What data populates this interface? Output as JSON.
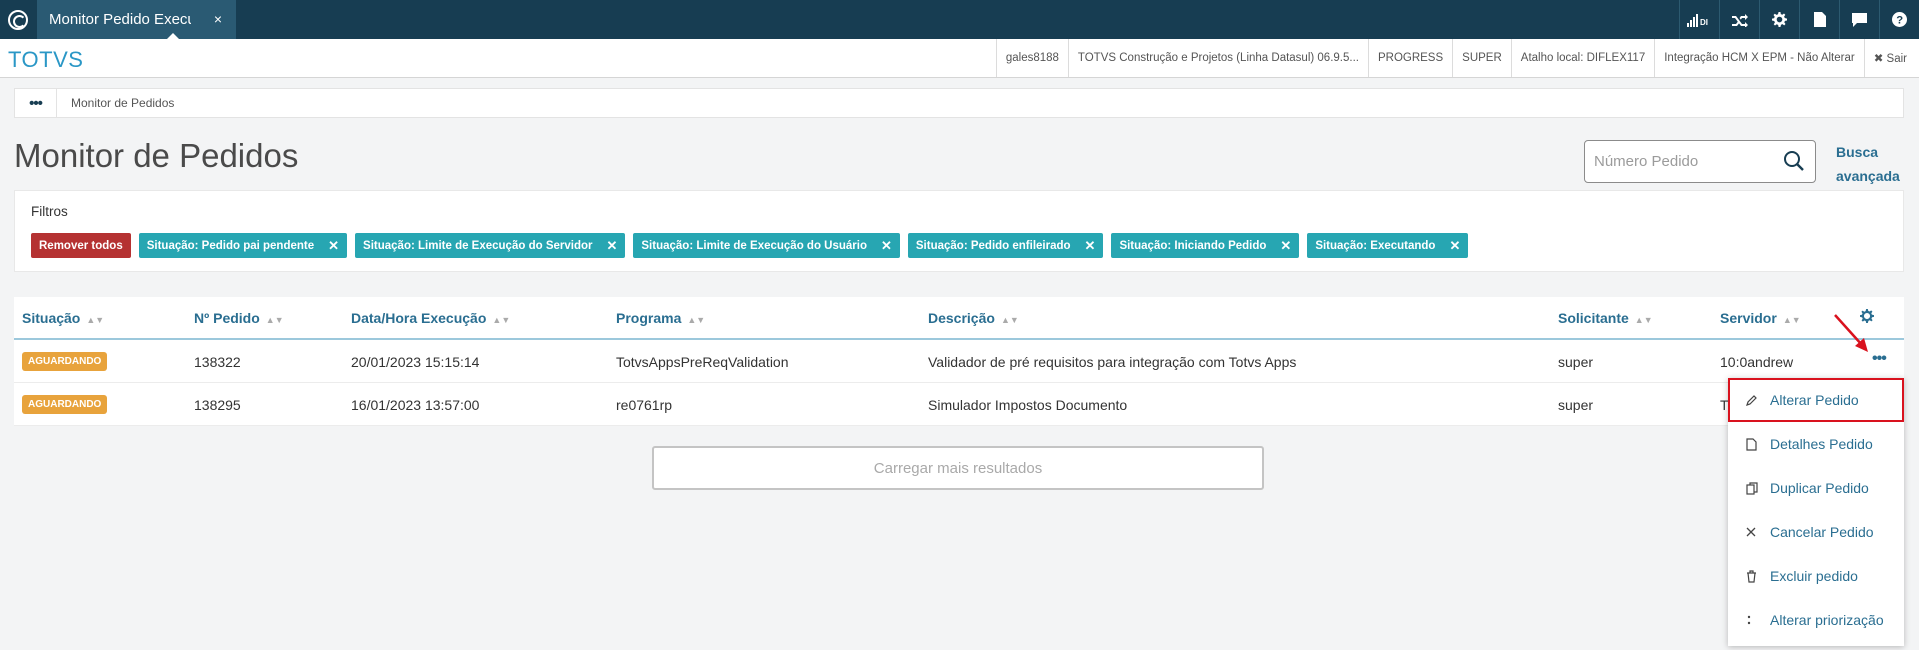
{
  "topbar": {
    "tab_title": "Monitor Pedido Execução",
    "tab_close": "×",
    "icons": [
      "signal-icon",
      "shuffle-icon",
      "gear-icon",
      "document-icon",
      "chat-icon",
      "help-icon"
    ],
    "signal_label": "DI"
  },
  "header": {
    "brand": "TOTVS",
    "info": [
      "gales8188",
      "TOTVS Construção e Projetos (Linha Datasul) 06.9.5...",
      "PROGRESS",
      "SUPER",
      "Atalho local: DIFLEX117",
      "Integração HCM X EPM - Não Alterar"
    ],
    "logout": "✖ Sair"
  },
  "breadcrumb": {
    "dots": "•••",
    "current": "Monitor de Pedidos"
  },
  "page": {
    "title": "Monitor de Pedidos",
    "search_placeholder": "Número Pedido",
    "advanced_search": "Busca avançada"
  },
  "filters": {
    "title": "Filtros",
    "remove_all": "Remover todos",
    "chips": [
      "Situação: Pedido pai pendente",
      "Situação: Limite de Execução do Servidor",
      "Situação: Limite de Execução do Usuário",
      "Situação: Pedido enfileirado",
      "Situação: Iniciando Pedido",
      "Situação: Executando"
    ]
  },
  "table": {
    "columns": [
      "Situação",
      "Nº Pedido",
      "Data/Hora Execução",
      "Programa",
      "Descrição",
      "Solicitante",
      "Servidor"
    ],
    "rows": [
      {
        "status": "AGUARDANDO",
        "pedido": "138322",
        "data": "20/01/2023 15:15:14",
        "programa": "TotvsAppsPreReqValidation",
        "descricao": "Validador de pré requisitos para integração com Totvs Apps",
        "solicitante": "super",
        "servidor": "10:0andrew"
      },
      {
        "status": "AGUARDANDO",
        "pedido": "138295",
        "data": "16/01/2023 13:57:00",
        "programa": "re0761rp",
        "descricao": "Simulador Impostos Documento",
        "solicitante": "super",
        "servidor": "T"
      }
    ],
    "row_actions": "•••"
  },
  "load_more": "Carregar mais resultados",
  "menu": {
    "items": [
      {
        "label": "Alterar Pedido",
        "icon": "pencil-icon"
      },
      {
        "label": "Detalhes Pedido",
        "icon": "document-icon"
      },
      {
        "label": "Duplicar Pedido",
        "icon": "copy-icon"
      },
      {
        "label": "Cancelar Pedido",
        "icon": "close-icon"
      },
      {
        "label": "Excluir pedido",
        "icon": "trash-icon"
      },
      {
        "label": "Alterar priorização",
        "icon": "priority-icon"
      }
    ]
  },
  "colors": {
    "topbar": "#173d52",
    "brand": "#2a97c6",
    "chip_remove": "#b53232",
    "chip_filter": "#27a6b2",
    "badge": "#e8a33c",
    "link": "#2a6e91",
    "highlight": "#d9121e"
  }
}
